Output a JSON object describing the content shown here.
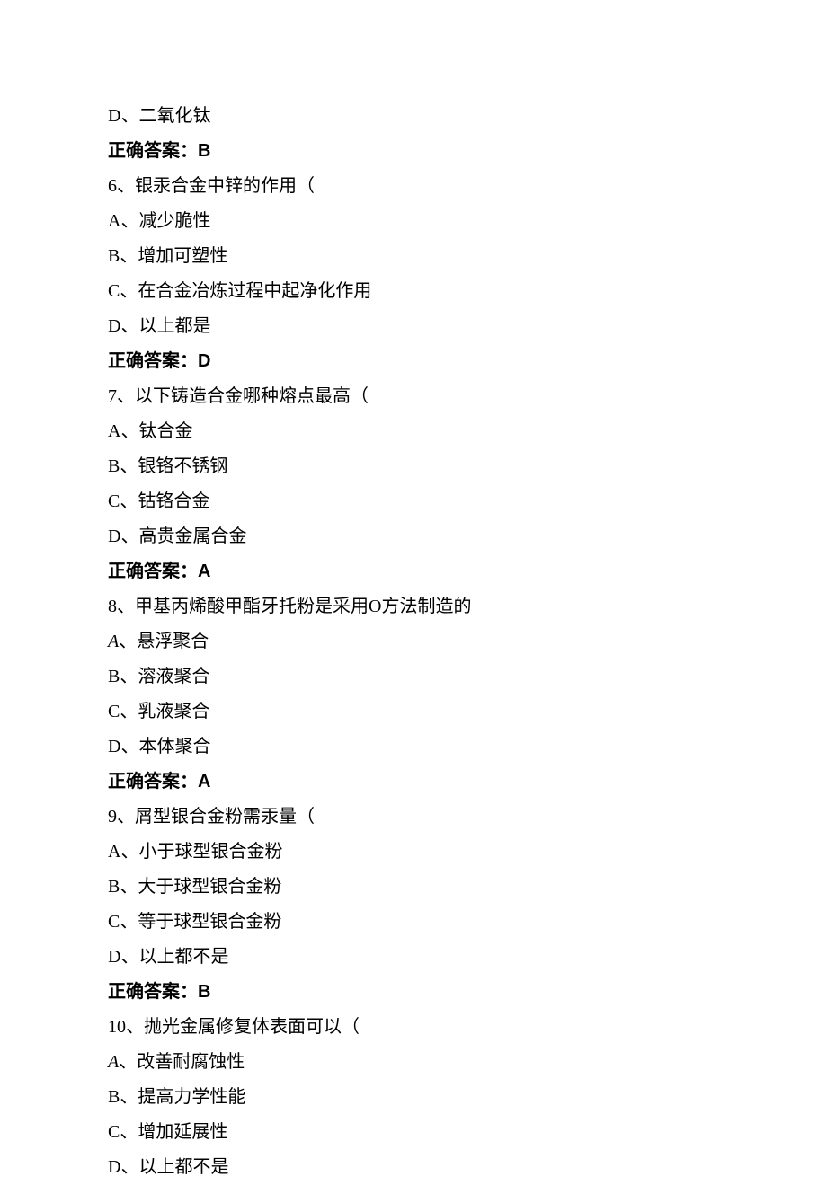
{
  "lines": [
    {
      "text": "D、二氧化钛",
      "bold": false,
      "italic": false
    },
    {
      "text": "正确答案：B",
      "bold": true,
      "italic": false
    },
    {
      "text": "6、银汞合金中锌的作用（",
      "bold": false,
      "italic": false
    },
    {
      "text": "A、减少脆性",
      "bold": false,
      "italic": false
    },
    {
      "text": "B、增加可塑性",
      "bold": false,
      "italic": false
    },
    {
      "text": "C、在合金冶炼过程中起净化作用",
      "bold": false,
      "italic": false
    },
    {
      "text": "D、以上都是",
      "bold": false,
      "italic": false
    },
    {
      "text": "正确答案：D",
      "bold": true,
      "italic": false
    },
    {
      "text": "7、以下铸造合金哪种熔点最高（",
      "bold": false,
      "italic": false
    },
    {
      "text": "A、钛合金",
      "bold": false,
      "italic": false
    },
    {
      "text": "B、银铬不锈钢",
      "bold": false,
      "italic": false
    },
    {
      "text": "C、钴铬合金",
      "bold": false,
      "italic": false
    },
    {
      "text": "D、高贵金属合金",
      "bold": false,
      "italic": false
    },
    {
      "text": "正确答案：A",
      "bold": true,
      "italic": false
    },
    {
      "text": "8、甲基丙烯酸甲酯牙托粉是采用O方法制造的",
      "bold": false,
      "italic": false
    },
    {
      "text": "A、悬浮聚合",
      "bold": false,
      "italic": true
    },
    {
      "text": "B、溶液聚合",
      "bold": false,
      "italic": false
    },
    {
      "text": "C、乳液聚合",
      "bold": false,
      "italic": false
    },
    {
      "text": "D、本体聚合",
      "bold": false,
      "italic": false
    },
    {
      "text": "正确答案：A",
      "bold": true,
      "italic": false
    },
    {
      "text": "9、屑型银合金粉需汞量（",
      "bold": false,
      "italic": false
    },
    {
      "text": "A、小于球型银合金粉",
      "bold": false,
      "italic": false
    },
    {
      "text": "B、大于球型银合金粉",
      "bold": false,
      "italic": false
    },
    {
      "text": "C、等于球型银合金粉",
      "bold": false,
      "italic": false
    },
    {
      "text": "D、以上都不是",
      "bold": false,
      "italic": false
    },
    {
      "text": "正确答案：B",
      "bold": true,
      "italic": false
    },
    {
      "text": "10、抛光金属修复体表面可以（",
      "bold": false,
      "italic": false
    },
    {
      "text": "A、改善耐腐蚀性",
      "bold": false,
      "italic": true
    },
    {
      "text": "B、提高力学性能",
      "bold": false,
      "italic": false
    },
    {
      "text": "C、增加延展性",
      "bold": false,
      "italic": false
    },
    {
      "text": "D、以上都不是",
      "bold": false,
      "italic": false
    }
  ]
}
